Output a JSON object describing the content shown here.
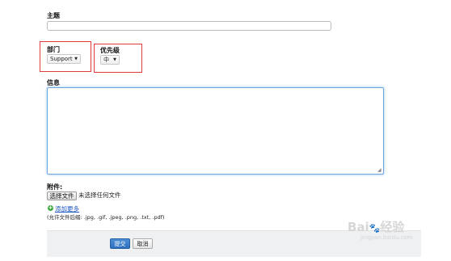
{
  "form": {
    "subject_label": "主题",
    "subject_value": "",
    "department_label": "部门",
    "department_value": "Support",
    "priority_label": "优先级",
    "priority_value": "中",
    "message_label": "信息",
    "message_value": "",
    "attachment_label": "附件:",
    "file_button_label": "选择文件",
    "file_status": "未选择任何文件",
    "add_more_label": "添加更多",
    "allowed_ext_note": "(允许文件后缀: .jpg, .gif, .jpeg, .png, .txt, .pdf)"
  },
  "actions": {
    "submit_label": "提交",
    "cancel_label": "取消"
  },
  "watermark": {
    "brand": "Bai",
    "brand2": "经验",
    "url": "jingyan.baidu.com"
  },
  "colors": {
    "highlight_border": "#e23b3b",
    "primary_button": "#2c6fbf",
    "add_icon": "#3aa83a"
  }
}
